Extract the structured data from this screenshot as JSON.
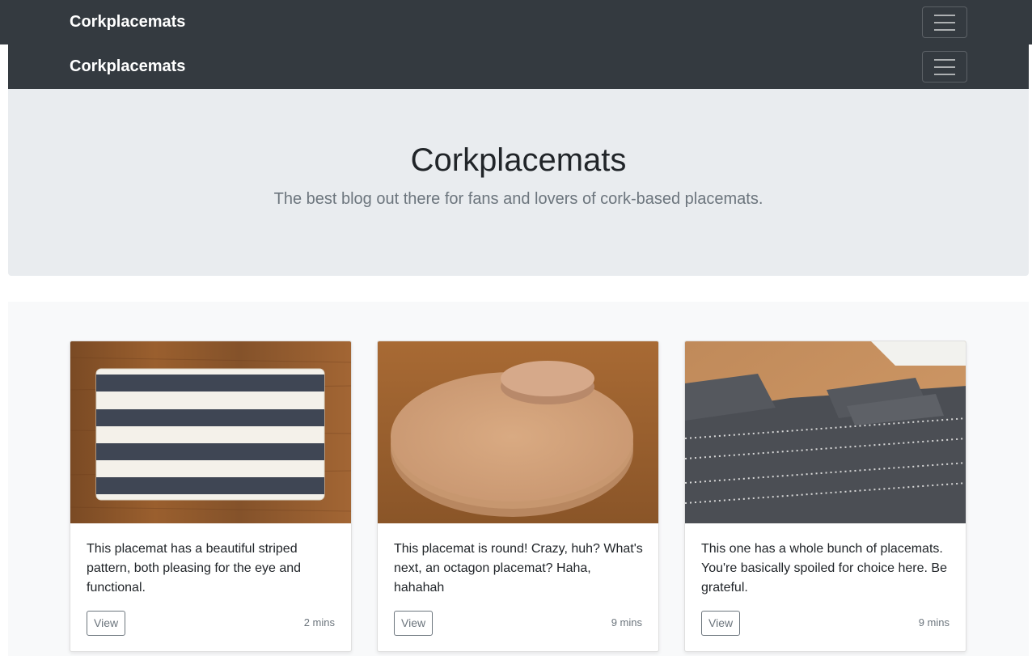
{
  "navbar": {
    "brand": "Corkplacemats",
    "toggler_icon": "hamburger-icon"
  },
  "navbar_duplicate": {
    "brand": "Corkplacemats",
    "toggler_icon": "hamburger-icon"
  },
  "hero": {
    "title": "Corkplacemats",
    "subtitle": "The best blog out there for fans and lovers of cork-based placemats."
  },
  "cards": [
    {
      "image": "striped-placemat-image",
      "text": "This placemat has a beautiful striped pattern, both pleasing for the eye and functional.",
      "button": "View",
      "time": "2 mins"
    },
    {
      "image": "round-cork-placemat-image",
      "text": "This placemat is round! Crazy, huh? What's next, an octagon placemat? Haha, hahahah",
      "button": "View",
      "time": "9 mins"
    },
    {
      "image": "patterned-placemat-set-image",
      "text": "This one has a whole bunch of placemats. You're basically spoiled for choice here. Be grateful.",
      "button": "View",
      "time": "9 mins"
    }
  ],
  "colors": {
    "navbar_bg": "#343a40",
    "jumbotron_bg": "#e9ecef",
    "album_bg": "#f8f9fa",
    "muted_text": "#6c757d"
  }
}
